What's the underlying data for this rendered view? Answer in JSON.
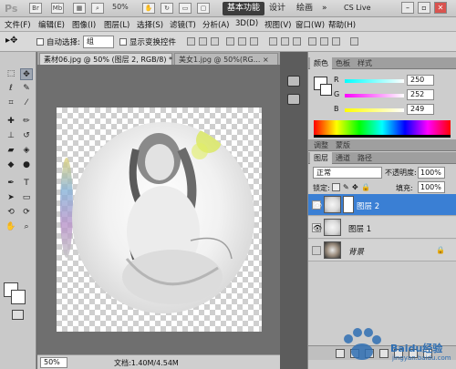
{
  "appbar": {
    "logo": "Ps",
    "zoom": "50%",
    "workspaces": [
      "基本功能",
      "设计",
      "绘画"
    ],
    "more": "»",
    "cs_live": "CS Live"
  },
  "menu": [
    "文件(F)",
    "编辑(E)",
    "图像(I)",
    "图层(L)",
    "选择(S)",
    "滤镜(T)",
    "分析(A)",
    "3D(D)",
    "视图(V)",
    "窗口(W)",
    "帮助(H)"
  ],
  "options": {
    "auto_select_label": "自动选择:",
    "auto_select_value": "组",
    "transform_label": "显示变换控件"
  },
  "doc_tabs": [
    {
      "label": "素材06.jpg @ 50% (图层 2, RGB/8) *",
      "close": "×"
    },
    {
      "label": "美女1.jpg @ 50%(RG...",
      "close": "×"
    }
  ],
  "status": {
    "zoom": "50%",
    "doc": "文档:1.40M/4.54M"
  },
  "color_panel": {
    "tabs": [
      "颜色",
      "色板",
      "样式"
    ],
    "r": "250",
    "g": "252",
    "b": "249",
    "r_label": "R",
    "g_label": "G",
    "b_label": "B"
  },
  "adjust_tabs": [
    "调整",
    "蒙版"
  ],
  "layers_panel": {
    "tabs": [
      "图层",
      "通道",
      "路径"
    ],
    "blend_mode": "正常",
    "opacity_label": "不透明度:",
    "opacity": "100%",
    "lock_label": "锁定:",
    "fill_label": "填充:",
    "fill": "100%",
    "layers": [
      {
        "name": "图层 2",
        "visible": true,
        "selected": true
      },
      {
        "name": "图层 1",
        "visible": true,
        "selected": false
      },
      {
        "name": "背景",
        "visible": false,
        "selected": false
      }
    ]
  },
  "watermark": {
    "brand": "Baidu经验",
    "sub": "jingyan.baidu.com"
  }
}
